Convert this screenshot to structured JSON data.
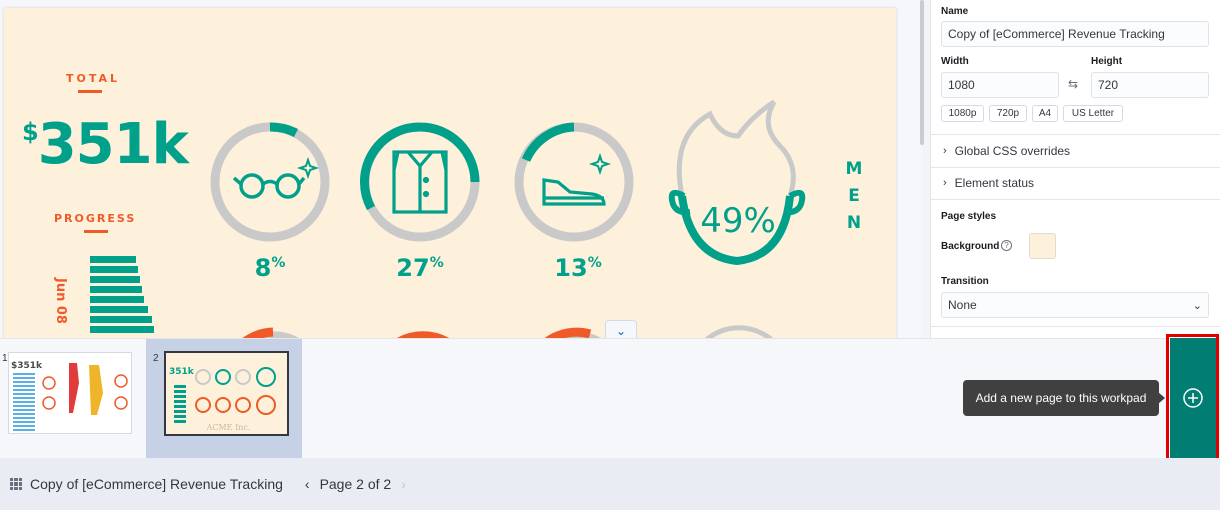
{
  "canvas": {
    "total_label": "TOTAL",
    "total_dollar": "$",
    "total_value": "351k",
    "progress_label": "PROGRESS",
    "progress_date": "Jun 08",
    "rings": [
      {
        "name": "glasses",
        "pct": "8",
        "unit": "%"
      },
      {
        "name": "shirt",
        "pct": "27",
        "unit": "%"
      },
      {
        "name": "shoes",
        "pct": "13",
        "unit": "%"
      }
    ],
    "head_pct": "49%",
    "men_label": "MEN"
  },
  "sidebar": {
    "name_label": "Name",
    "name_value": "Copy of [eCommerce] Revenue Tracking",
    "width_label": "Width",
    "width_value": "1080",
    "height_label": "Height",
    "height_value": "720",
    "presets": [
      "1080p",
      "720p",
      "A4",
      "US Letter"
    ],
    "accordion_css": "Global CSS overrides",
    "accordion_status": "Element status",
    "page_styles_label": "Page styles",
    "background_label": "Background",
    "background_color": "#fdf1dc",
    "transition_label": "Transition",
    "transition_value": "None"
  },
  "tray": {
    "page1_number": "1",
    "page2_number": "2",
    "thumb2_total": "351k",
    "thumb2_footer": "ACME Inc.",
    "thumb1_total": "$351k",
    "add_tooltip": "Add a new page to this workpad"
  },
  "footer": {
    "workpad_title": "Copy of [eCommerce] Revenue Tracking",
    "page_indicator": "Page 2 of 2"
  },
  "colors": {
    "accent_teal": "#00a08a",
    "accent_orange": "#f05a28",
    "add_button": "#017d73",
    "highlight": "#e00000"
  }
}
